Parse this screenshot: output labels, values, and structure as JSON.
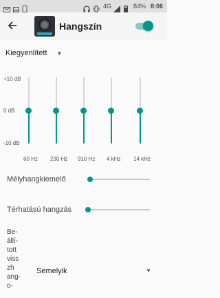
{
  "status_bar": {
    "icons": [
      "email-icon",
      "image-icon",
      "phone-icon",
      "headset-icon",
      "vibrate-icon",
      "signal-icon",
      "battery-icon"
    ],
    "network": "4G",
    "battery": "84%",
    "time": "8:06"
  },
  "app_bar": {
    "title": "Hangszín",
    "back_icon": "arrow-back-icon",
    "app_icon": "speaker-icon",
    "enabled": true,
    "accent_color": "#009688"
  },
  "preset": {
    "value": "Kiegyenlített"
  },
  "equalizer": {
    "db_labels": {
      "max": "+10 dB",
      "mid": "0 dB",
      "min": "-10 dB"
    },
    "range_db": [
      -10,
      10
    ],
    "bands": [
      {
        "label": "60 Hz",
        "level_db": 0
      },
      {
        "label": "230 Hz",
        "level_db": 0
      },
      {
        "label": "910 Hz",
        "level_db": 0
      },
      {
        "label": "4 kHz",
        "level_db": 0
      },
      {
        "label": "14 kHz",
        "level_db": 0
      }
    ]
  },
  "bass_boost": {
    "label": "Mélyhangkiemelő",
    "level": 0
  },
  "virtualizer": {
    "label": "Térhatású hangzás",
    "level": 0
  },
  "reverb": {
    "label": "Be-\nállí-\ntott\nviss\nzh\nang-\no-",
    "value": "Semelyik"
  }
}
